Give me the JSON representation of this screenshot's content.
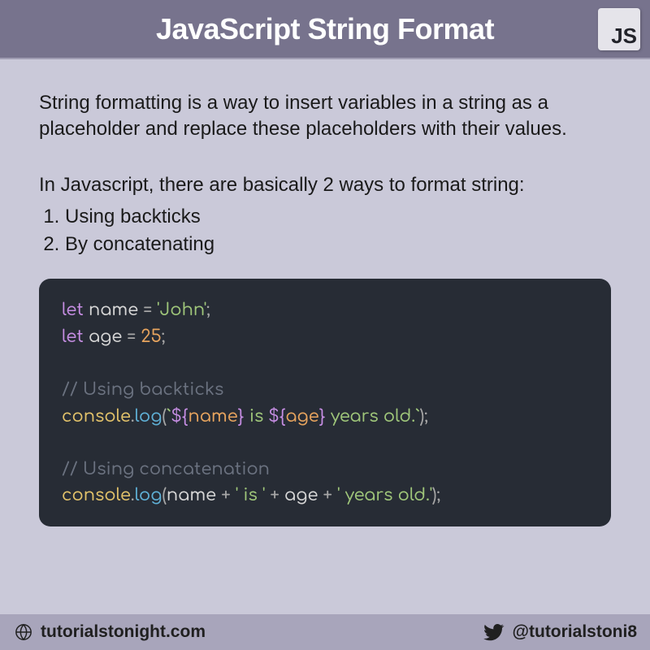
{
  "header": {
    "title": "JavaScript String Format",
    "badge": "JS"
  },
  "content": {
    "intro": "String formatting is a way to insert variables in a string as a placeholder and replace these placeholders with their values.",
    "ways_intro": "In Javascript, there are basically 2 ways to format string:",
    "ways": {
      "item1": "Using backticks",
      "item2": "By concatenating"
    }
  },
  "code": {
    "let1": "let",
    "sp": " ",
    "name_var": "name",
    "eq": " = ",
    "name_val": "'John'",
    "semi": ";",
    "let2": "let",
    "age_var": "age",
    "age_val": "25",
    "cmt1": "// Using backticks",
    "console": "console",
    "dot": ".",
    "log": "log",
    "lp": "(",
    "rp": ")",
    "bt_open": "`",
    "tmpl_open1": "${",
    "tmpl_name": "name",
    "tmpl_close": "}",
    "lit_is": " is ",
    "tmpl_open2": "${",
    "tmpl_age": "age",
    "lit_years": " years old.",
    "bt_close": "`",
    "cmt2": "// Using concatenation",
    "plus": " + ",
    "str_is": "' is '",
    "str_years": "' years old.'"
  },
  "footer": {
    "site": "tutorialstonight.com",
    "handle": "@tutorialstoni8"
  }
}
